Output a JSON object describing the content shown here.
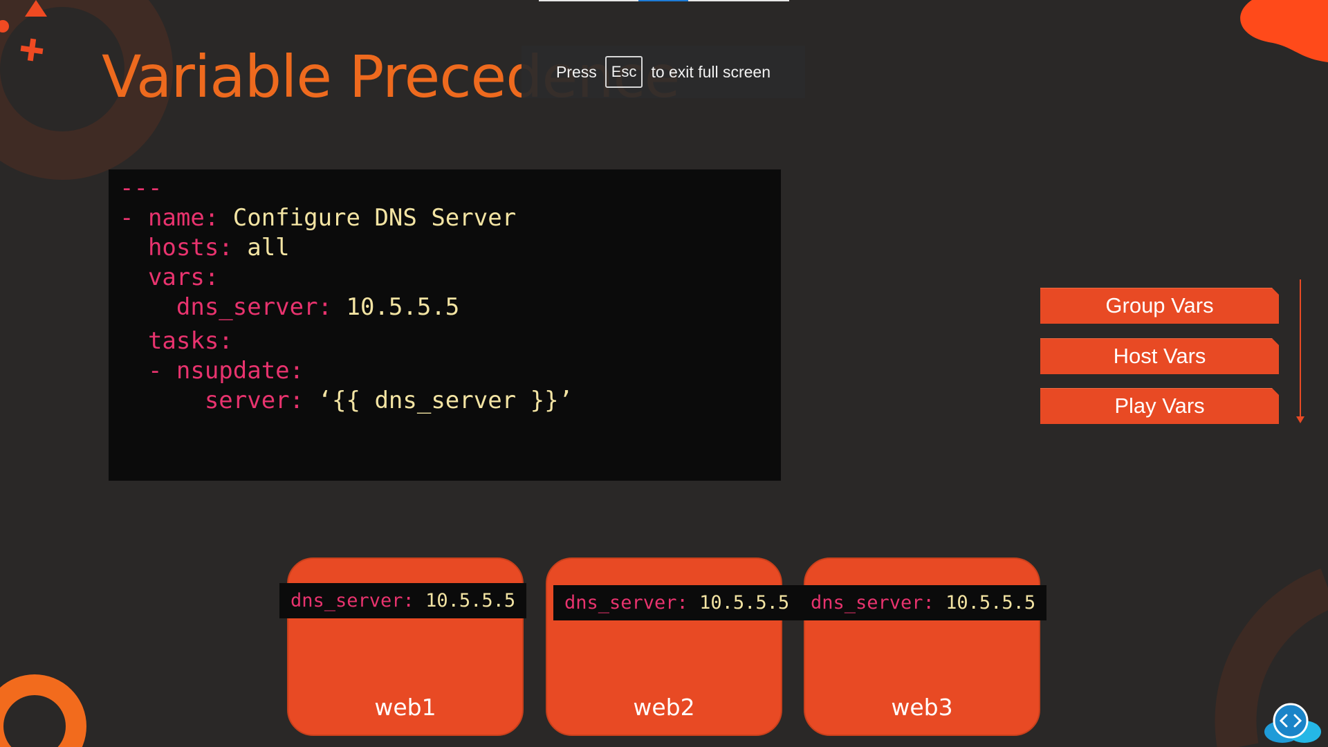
{
  "slide": {
    "title": "Variable Precedence",
    "code_lines": [
      [
        {
          "t": "---",
          "c": "k"
        }
      ],
      [
        {
          "t": "- name: ",
          "c": "k"
        },
        {
          "t": "Configure DNS Server",
          "c": "v"
        }
      ],
      [
        {
          "t": "  hosts: ",
          "c": "k"
        },
        {
          "t": "all",
          "c": "v"
        }
      ],
      [
        {
          "t": "  vars:",
          "c": "k"
        }
      ],
      [
        {
          "t": "    dns_server: ",
          "c": "k"
        },
        {
          "t": "10.5.5.5",
          "c": "v"
        }
      ],
      [
        {
          "t": "  tasks:",
          "c": "k"
        }
      ],
      [
        {
          "t": "  - nsupdate:",
          "c": "k"
        }
      ],
      [
        {
          "t": "      server: ",
          "c": "k"
        },
        {
          "t": "‘{{ dns_server }}’",
          "c": "v"
        }
      ]
    ],
    "precedence": {
      "items": [
        "Group Vars",
        "Host Vars",
        "Play Vars"
      ]
    },
    "servers": [
      {
        "name": "web1",
        "var_key": "dns_server: ",
        "var_value": "10.5.5.5"
      },
      {
        "name": "web2",
        "var_key": "dns_server: ",
        "var_value": "10.5.5.5"
      },
      {
        "name": "web3",
        "var_key": "dns_server: ",
        "var_value": "10.5.5.5"
      }
    ]
  },
  "fullscreen_banner": {
    "press": "Press",
    "key": "Esc",
    "message": "to exit full screen"
  },
  "colors": {
    "background": "#2a2827",
    "accent_orange": "#e84a24",
    "title_orange": "#ee6a1e",
    "code_key_pink": "#e8336e",
    "code_value_yellow": "#f3e4a3"
  },
  "icons": [
    "triangle-icon",
    "plus-icon",
    "cloud-code-logo-icon"
  ]
}
